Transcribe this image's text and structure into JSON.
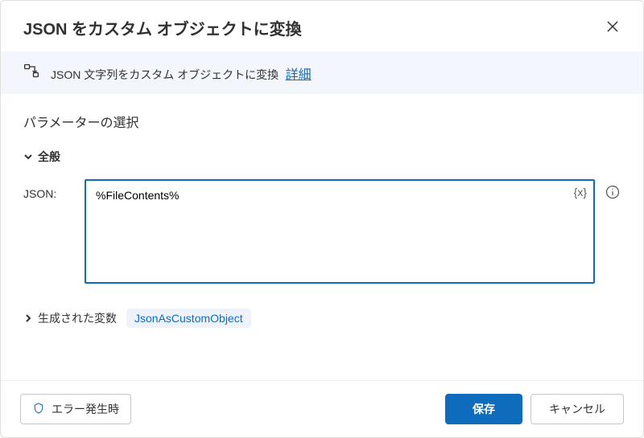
{
  "header": {
    "title": "JSON をカスタム オブジェクトに変換"
  },
  "info": {
    "text": "JSON 文字列をカスタム オブジェクトに変換",
    "link": "詳細"
  },
  "params": {
    "section_title": "パラメーターの選択",
    "general_label": "全般",
    "json_label": "JSON:",
    "json_value": "%FileContents%",
    "var_button": "{x}"
  },
  "generated": {
    "label": "生成された変数",
    "variable": "JsonAsCustomObject"
  },
  "footer": {
    "error_label": "エラー発生時",
    "save": "保存",
    "cancel": "キャンセル"
  }
}
